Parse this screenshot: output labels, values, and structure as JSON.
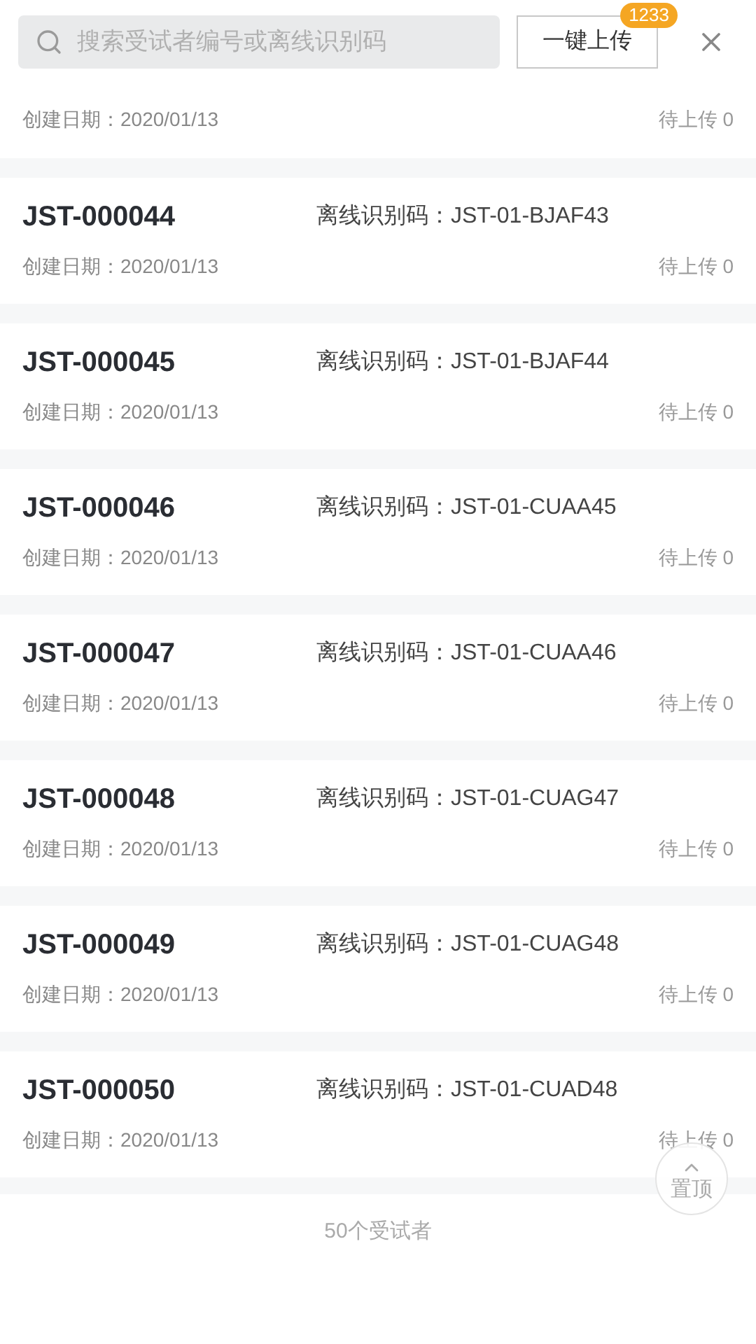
{
  "header": {
    "search": {
      "placeholder": "搜索受试者编号或离线识别码"
    },
    "upload_button": "一键上传",
    "badge": "1233"
  },
  "partial_record": {
    "date": "创建日期：2020/01/13",
    "status": "待上传 0"
  },
  "records": [
    {
      "id": "JST-000044",
      "code_label": "离线识别码：",
      "code": "JST-01-BJAF43",
      "date": "创建日期：2020/01/13",
      "status": "待上传 0"
    },
    {
      "id": "JST-000045",
      "code_label": "离线识别码：",
      "code": "JST-01-BJAF44",
      "date": "创建日期：2020/01/13",
      "status": "待上传 0"
    },
    {
      "id": "JST-000046",
      "code_label": "离线识别码：",
      "code": "JST-01-CUAA45",
      "date": "创建日期：2020/01/13",
      "status": "待上传 0"
    },
    {
      "id": "JST-000047",
      "code_label": "离线识别码：",
      "code": "JST-01-CUAA46",
      "date": "创建日期：2020/01/13",
      "status": "待上传 0"
    },
    {
      "id": "JST-000048",
      "code_label": "离线识别码：",
      "code": "JST-01-CUAG47",
      "date": "创建日期：2020/01/13",
      "status": "待上传 0"
    },
    {
      "id": "JST-000049",
      "code_label": "离线识别码：",
      "code": "JST-01-CUAG48",
      "date": "创建日期：2020/01/13",
      "status": "待上传 0"
    },
    {
      "id": "JST-000050",
      "code_label": "离线识别码：",
      "code": "JST-01-CUAD48",
      "date": "创建日期：2020/01/13",
      "status": "待上传 0"
    }
  ],
  "back_to_top": "置顶",
  "footer": "50个受试者"
}
